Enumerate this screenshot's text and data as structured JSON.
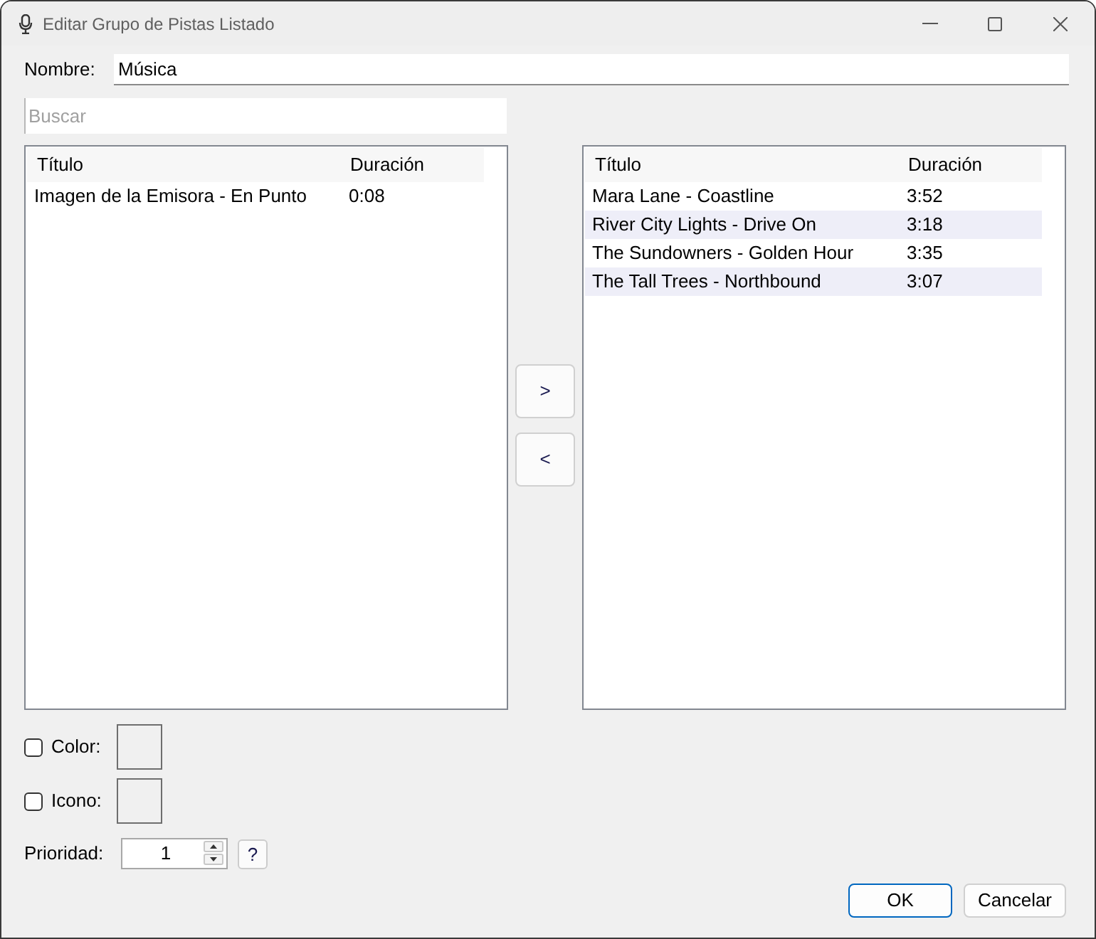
{
  "window": {
    "title": "Editar Grupo de Pistas Listado"
  },
  "name_field": {
    "label": "Nombre:",
    "value": "Música"
  },
  "search": {
    "placeholder": "Buscar"
  },
  "available_list": {
    "columns": [
      "Título",
      "Duración"
    ],
    "rows": [
      {
        "title": "Imagen de la Emisora - En Punto",
        "duration": "0:08"
      }
    ]
  },
  "transfer_buttons": [
    ">",
    "<"
  ],
  "selected_list": {
    "columns": [
      "Título",
      "Duración"
    ],
    "rows": [
      {
        "title": "Mara Lane - Coastline",
        "duration": "3:52"
      },
      {
        "title": "River City Lights - Drive On",
        "duration": "3:18"
      },
      {
        "title": "The Sundowners - Golden Hour",
        "duration": "3:35"
      },
      {
        "title": "The Tall Trees - Northbound",
        "duration": "3:07"
      }
    ]
  },
  "options": [
    {
      "label": "Color:",
      "checked": false
    },
    {
      "label": "Icono:",
      "checked": false
    }
  ],
  "priority": {
    "label": "Prioridad:",
    "value": "1",
    "help": "?"
  },
  "buttons": [
    {
      "label": "OK",
      "default": true
    },
    {
      "label": "Cancelar",
      "default": false
    }
  ]
}
